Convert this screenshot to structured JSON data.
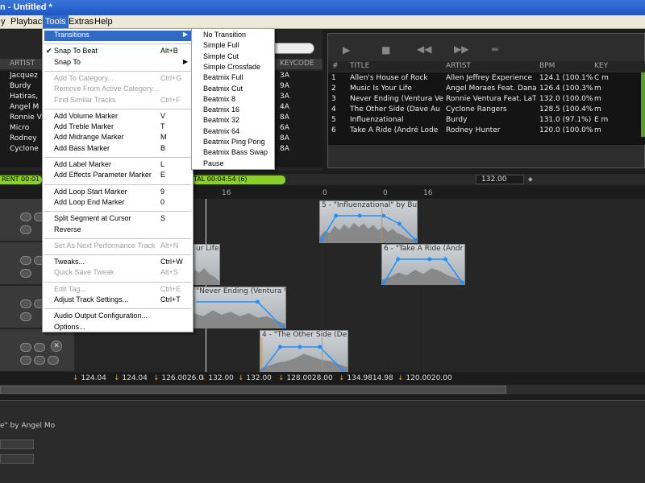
{
  "window": {
    "title": "n - Untitled *"
  },
  "menubar": {
    "items": [
      "y",
      "Playback",
      "Tools",
      "Extras",
      "Help"
    ]
  },
  "left_table": {
    "headers": [
      "ARTIST",
      "KEYCODE"
    ],
    "rows": [
      {
        "artist": "Jacquez",
        "key": "3A"
      },
      {
        "artist": "Burdy",
        "key": "9A"
      },
      {
        "artist": "Hatiras,",
        "key": "3A"
      },
      {
        "artist": "Angel M",
        "key": "4A"
      },
      {
        "artist": "Ronnie V",
        "key": "8A"
      },
      {
        "artist": "Micro",
        "key": "6A"
      },
      {
        "artist": "Rodney",
        "key": "8A"
      },
      {
        "artist": "Cyclone",
        "key": "8A"
      }
    ]
  },
  "right_table": {
    "headers": [
      "#",
      "TITLE",
      "ARTIST",
      "BPM",
      "KEY"
    ],
    "rows": [
      {
        "n": "1",
        "title": "Allen's House of Rock",
        "artist": "Allen Jeffrey Experience",
        "bpm": "124.1 (100.1%",
        "key": "C m"
      },
      {
        "n": "2",
        "title": "Music Is Your Life",
        "artist": "Angel Moraes Feat. Dana",
        "bpm": "126.4 (100.3% F",
        "key": "m"
      },
      {
        "n": "3",
        "title": "Never Ending (Ventura Ve",
        "artist": "Ronnie Ventura Feat. LaT",
        "bpm": "132.0 (100.0% A",
        "key": "m"
      },
      {
        "n": "4",
        "title": "The Other Side (Dave Au",
        "artist": "Cyclone Rangers",
        "bpm": "128.5 (100.4% A",
        "key": "m"
      },
      {
        "n": "5",
        "title": "Influenzational",
        "artist": "Burdy",
        "bpm": "131.0 (97.1%)",
        "key": "E m"
      },
      {
        "n": "6",
        "title": "Take A Ride (André Lode",
        "artist": "Rodney Hunter",
        "bpm": "120.0 (100.0% A",
        "key": "m"
      }
    ]
  },
  "status": {
    "current": "RENT 00:01",
    "total": "TAL 00:04:54 (6)"
  },
  "zoom": "132.00",
  "ruler": {
    "left_ticks": [
      "16"
    ],
    "right_ticks": [
      "0",
      "0",
      "16"
    ]
  },
  "tools_menu": {
    "items": [
      {
        "label": "Transitions",
        "shortcut": "",
        "submenu": true,
        "highlight": true
      },
      {
        "sep": true
      },
      {
        "label": "Snap To Beat",
        "shortcut": "Alt+B",
        "checked": true
      },
      {
        "label": "Snap To",
        "shortcut": "",
        "submenu": true
      },
      {
        "sep": true
      },
      {
        "label": "Add To Category...",
        "shortcut": "Ctrl+G",
        "disabled": true
      },
      {
        "label": "Remove From Active Category...",
        "shortcut": "",
        "disabled": true
      },
      {
        "label": "Find Similar Tracks",
        "shortcut": "Ctrl+F",
        "disabled": true
      },
      {
        "sep": true
      },
      {
        "label": "Add Volume Marker",
        "shortcut": "V"
      },
      {
        "label": "Add Treble Marker",
        "shortcut": "T"
      },
      {
        "label": "Add Midrange Marker",
        "shortcut": "M"
      },
      {
        "label": "Add Bass Marker",
        "shortcut": "B"
      },
      {
        "sep": true
      },
      {
        "label": "Add Label Marker",
        "shortcut": "L"
      },
      {
        "label": "Add Effects Parameter Marker",
        "shortcut": "E"
      },
      {
        "sep": true
      },
      {
        "label": "Add Loop Start Marker",
        "shortcut": "9"
      },
      {
        "label": "Add Loop End Marker",
        "shortcut": "0"
      },
      {
        "sep": true
      },
      {
        "label": "Split Segment at Cursor",
        "shortcut": "S"
      },
      {
        "label": "Reverse",
        "shortcut": ""
      },
      {
        "sep": true
      },
      {
        "label": "Set As Next Performance Track",
        "shortcut": "Alt+N",
        "disabled": true
      },
      {
        "sep": true
      },
      {
        "label": "Tweaks...",
        "shortcut": "Ctrl+W"
      },
      {
        "label": "Quick Save Tweak",
        "shortcut": "Alt+S",
        "disabled": true
      },
      {
        "sep": true
      },
      {
        "label": "Edit Tag...",
        "shortcut": "Ctrl+E",
        "disabled": true
      },
      {
        "label": "Adjust Track Settings...",
        "shortcut": "Ctrl+T"
      },
      {
        "sep": true
      },
      {
        "label": "Audio Output Configuration...",
        "shortcut": ""
      },
      {
        "label": "Options...",
        "shortcut": ""
      }
    ]
  },
  "transitions_menu": {
    "items": [
      "No Transition",
      "Simple Full",
      "Simple Cut",
      "Simple Crossfade",
      "Beatmix Full",
      "Beatmix Cut",
      "Beatmix 8",
      "Beatmix 16",
      "Beatmix 32",
      "Beatmix 64",
      "Beatmix Ping Pong",
      "Beatmix Bass Swap",
      "Pause"
    ]
  },
  "segments": [
    {
      "title": "5 - \"Influenzational\" by Bur"
    },
    {
      "title": "6 - \"Take A Ride (Andr"
    },
    {
      "title": "ur Life\""
    },
    {
      "title": "\"Never Ending (Ventura Ve"
    },
    {
      "title": "4 - \"The Other Side (De"
    }
  ],
  "bpm_row": [
    "124.04",
    "124.04",
    "126.0026.0",
    "132.00",
    "132.00",
    "128.0028.00",
    "134.9814.98",
    "120.0020.00"
  ],
  "bottom": {
    "label": "e\" by Angel Mo"
  },
  "colors": {
    "accent": "#316ac5",
    "marker": "#1e90ff",
    "status_green": "#8ccf2a",
    "bpm": "#d7a640"
  }
}
